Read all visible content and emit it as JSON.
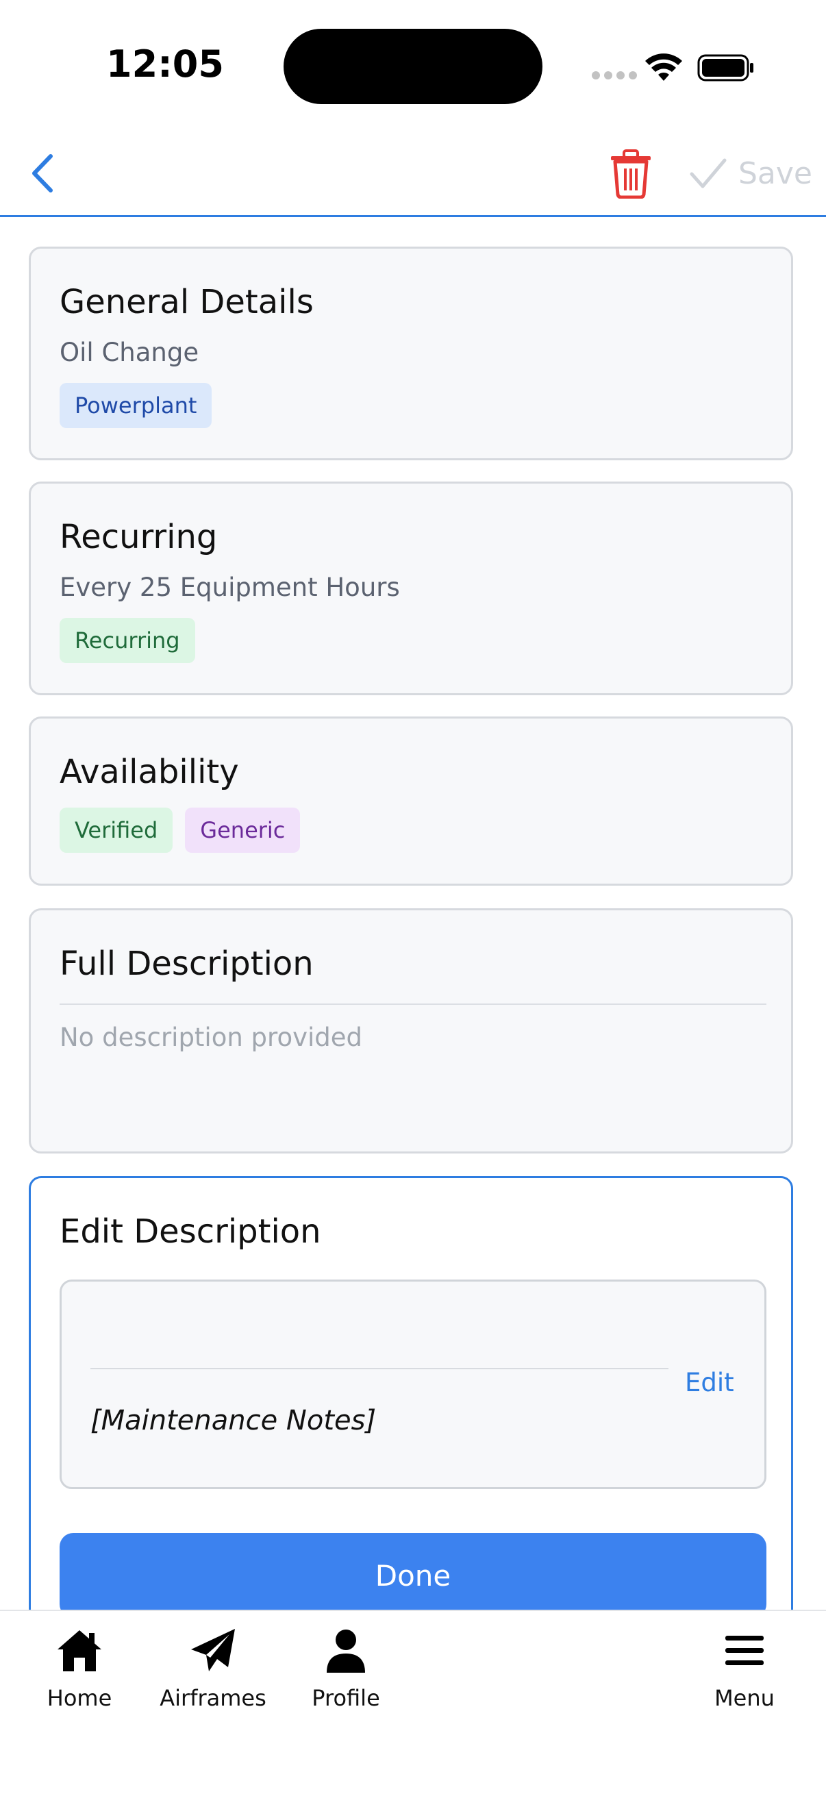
{
  "status": {
    "time": "12:05"
  },
  "header": {
    "save_label": "Save"
  },
  "cards": {
    "general": {
      "title": "General Details",
      "subtitle": "Oil Change",
      "badges": [
        "Powerplant"
      ]
    },
    "recurring": {
      "title": "Recurring",
      "subtitle": "Every 25 Equipment Hours",
      "badges": [
        "Recurring"
      ]
    },
    "availability": {
      "title": "Availability",
      "badges": [
        "Verified",
        "Generic"
      ]
    },
    "full_description": {
      "title": "Full Description",
      "text": "No description provided"
    },
    "edit_description": {
      "title": "Edit Description",
      "edit_label": "Edit",
      "notes": "[Maintenance Notes]",
      "done_label": "Done"
    }
  },
  "tabs": [
    {
      "label": "Home",
      "icon": "house-icon"
    },
    {
      "label": "Airframes",
      "icon": "paper-plane-icon"
    },
    {
      "label": "Profile",
      "icon": "person-icon"
    },
    {
      "label": "Menu",
      "icon": "menu-icon"
    }
  ],
  "colors": {
    "accent": "#2e7de1",
    "delete": "#e53935",
    "done_button": "#3c82ef"
  }
}
